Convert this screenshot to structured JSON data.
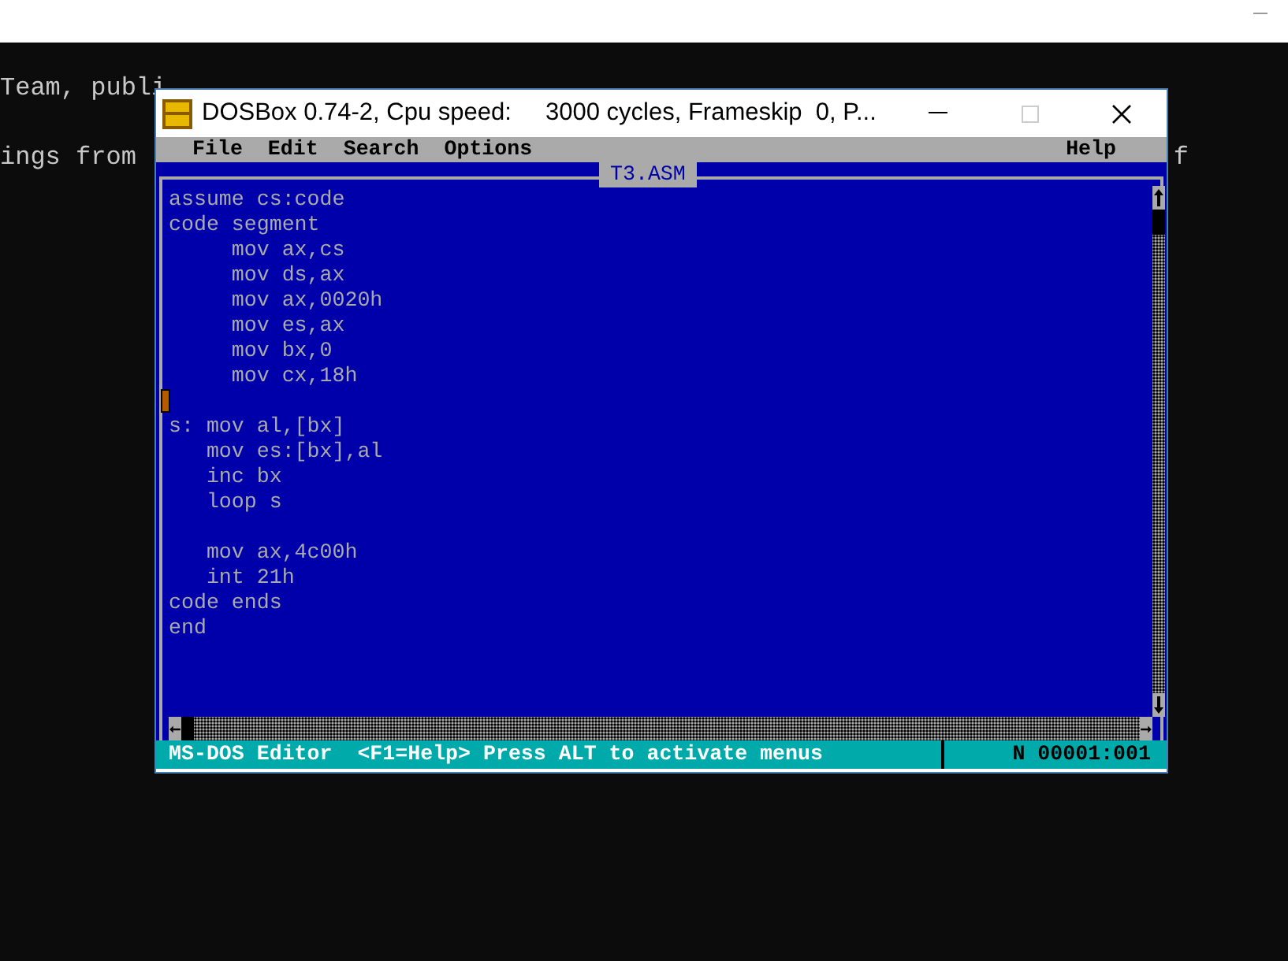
{
  "terminal": {
    "lines": [
      {
        "text": "Team, publi"
      },
      {
        "text": "ings from",
        "right_text": "f"
      }
    ]
  },
  "window": {
    "title": "DOSBox 0.74-2, Cpu speed:     3000 cycles, Frameskip  0, P...",
    "menu": [
      {
        "label": "File"
      },
      {
        "label": "Edit"
      },
      {
        "label": "Search"
      },
      {
        "label": "Options"
      }
    ],
    "help_menu": {
      "label": "Help"
    },
    "document": {
      "title": "T3.ASM",
      "lines": [
        {
          "kind": "code",
          "text": "assume cs:code"
        },
        {
          "kind": "code",
          "text": "code segment"
        },
        {
          "kind": "code",
          "text": "     mov ax,cs"
        },
        {
          "kind": "code",
          "text": "     mov ds,ax"
        },
        {
          "kind": "code",
          "text": "     mov ax,0020h"
        },
        {
          "kind": "code",
          "text": "     mov es,ax"
        },
        {
          "kind": "code",
          "text": "     mov bx,0"
        },
        {
          "kind": "code",
          "text": "     mov cx,18h"
        },
        {
          "kind": "blank"
        },
        {
          "kind": "code",
          "text": "s: mov al,[bx]"
        },
        {
          "kind": "code",
          "text": "   mov es:[bx],al"
        },
        {
          "kind": "code",
          "text": "   inc bx"
        },
        {
          "kind": "code",
          "text": "   loop s"
        },
        {
          "kind": "blank"
        },
        {
          "kind": "code",
          "text": "   mov ax,4c00h"
        },
        {
          "kind": "code",
          "text": "   int 21h"
        },
        {
          "kind": "code",
          "text": "code ends"
        },
        {
          "kind": "code",
          "text": "end"
        }
      ]
    },
    "status_bar": {
      "message": "MS-DOS Editor  <F1=Help> Press ALT to activate menus",
      "position": "N 00001:001"
    }
  }
}
